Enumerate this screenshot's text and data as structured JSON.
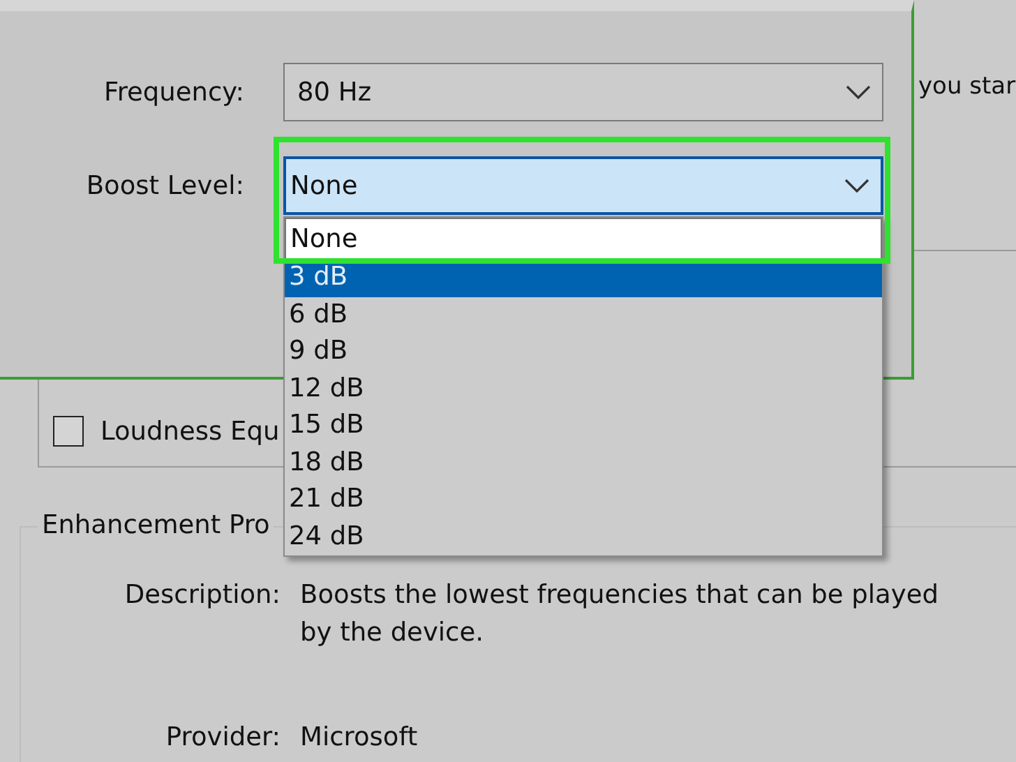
{
  "background": {
    "side_text": "you star",
    "checkboxes": [
      {
        "label": "Loudness Equ",
        "checked": false
      }
    ],
    "enhancement_properties": {
      "legend": "Enhancement Pro",
      "rows": [
        {
          "label": "Description:",
          "value": "Boosts the lowest frequencies that can be played by the device."
        },
        {
          "label": "Provider:",
          "value": "Microsoft"
        }
      ]
    }
  },
  "dialog": {
    "fields": [
      {
        "label": "Frequency:",
        "value": "80 Hz",
        "focused": false
      },
      {
        "label": "Boost Level:",
        "value": "None",
        "focused": true,
        "highlighted": true,
        "options": [
          {
            "label": "None",
            "selected": true,
            "highlighted": false
          },
          {
            "label": "3 dB",
            "selected": false,
            "highlighted": true
          },
          {
            "label": "6 dB",
            "selected": false,
            "highlighted": false
          },
          {
            "label": "9 dB",
            "selected": false,
            "highlighted": false
          },
          {
            "label": "12 dB",
            "selected": false,
            "highlighted": false
          },
          {
            "label": "15 dB",
            "selected": false,
            "highlighted": false
          },
          {
            "label": "18 dB",
            "selected": false,
            "highlighted": false
          },
          {
            "label": "21 dB",
            "selected": false,
            "highlighted": false
          },
          {
            "label": "24 dB",
            "selected": false,
            "highlighted": false
          }
        ]
      }
    ]
  }
}
